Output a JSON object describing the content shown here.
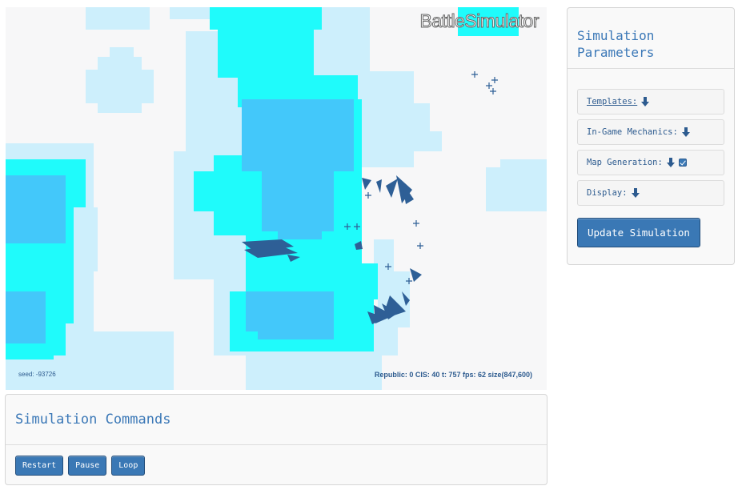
{
  "map": {
    "title": "BattleSimulator",
    "seed": "seed: -93726",
    "stats": "Republic: 0 CIS: 40 t: 757 fps: 62 size(847,600)",
    "colors": {
      "background": "#f7f7f8",
      "light": "#cdeffc",
      "cyan": "#1ffbfb",
      "deep": "#43c8fa",
      "unit": "#2e5f96"
    }
  },
  "commands": {
    "title": "Simulation Commands",
    "buttons": [
      "Restart",
      "Pause",
      "Loop"
    ]
  },
  "params": {
    "title_line1": "Simulation",
    "title_line2": "Parameters",
    "sections": [
      {
        "label": "Templates:",
        "icon": "arrow-down-icon"
      },
      {
        "label": "In-Game Mechanics:",
        "icon": "arrow-down-icon"
      },
      {
        "label": "Map Generation:",
        "icon": "arrow-down-icon",
        "checked": true
      },
      {
        "label": "Display:",
        "icon": "arrow-down-icon"
      }
    ],
    "update_label": "Update Simulation"
  }
}
